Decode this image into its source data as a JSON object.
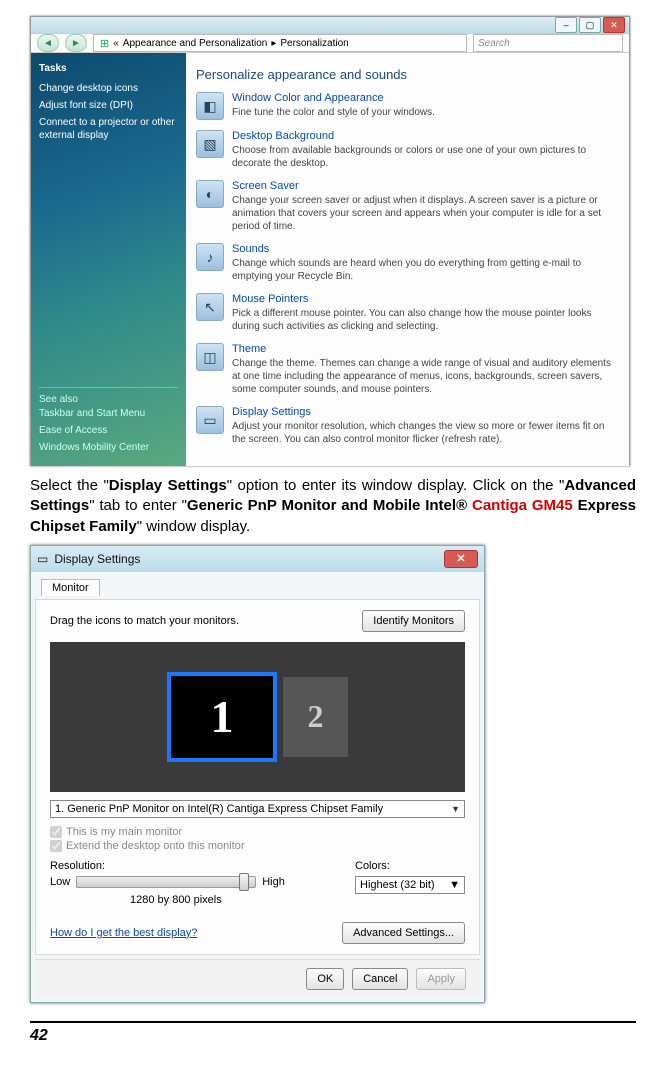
{
  "win1": {
    "breadcrumb_prefix": "«",
    "breadcrumb1": "Appearance and Personalization",
    "breadcrumb_sep": "▸",
    "breadcrumb2": "Personalization",
    "search_placeholder": "Search",
    "sidebar": {
      "heading": "Tasks",
      "tasks": [
        "Change desktop icons",
        "Adjust font size (DPI)",
        "Connect to a projector or other external display"
      ],
      "seealso_heading": "See also",
      "seealso": [
        "Taskbar and Start Menu",
        "Ease of Access",
        "Windows Mobility Center"
      ]
    },
    "main_heading": "Personalize appearance and sounds",
    "items": [
      {
        "icon": "◧",
        "title": "Window Color and Appearance",
        "desc": "Fine tune the color and style of your windows."
      },
      {
        "icon": "▧",
        "title": "Desktop Background",
        "desc": "Choose from available backgrounds or colors or use one of your own pictures to decorate the desktop."
      },
      {
        "icon": "◐",
        "title": "Screen Saver",
        "desc": "Change your screen saver or adjust when it displays. A screen saver is a picture or animation that covers your screen and appears when your computer is idle for a set period of time."
      },
      {
        "icon": "♪",
        "title": "Sounds",
        "desc": "Change which sounds are heard when you do everything from getting e-mail to emptying your Recycle Bin."
      },
      {
        "icon": "↖",
        "title": "Mouse Pointers",
        "desc": "Pick a different mouse pointer. You can also change how the mouse pointer looks during such activities as clicking and selecting."
      },
      {
        "icon": "◫",
        "title": "Theme",
        "desc": "Change the theme. Themes can change a wide range of visual and auditory elements at one time including the appearance of menus, icons, backgrounds, screen savers, some computer sounds, and mouse pointers."
      },
      {
        "icon": "▭",
        "title": "Display Settings",
        "desc": "Adjust your monitor resolution, which changes the view so more or fewer items fit on the screen. You can also control monitor flicker (refresh rate)."
      }
    ]
  },
  "instr": {
    "t1": "Select the \"",
    "b1": "Display Settings",
    "t2": "\" option to enter its window display. Click on the \"",
    "b2": "Advanced Settings",
    "t3": "\" tab to enter \"",
    "b3": "Generic PnP Monitor and Mobile Intel® ",
    "red": "Cantiga GM45",
    "b4": " Express Chipset Family",
    "t4": "\" window display."
  },
  "dlg": {
    "icon": "▭",
    "title": "Display Settings",
    "tab": "Monitor",
    "drag_label": "Drag the icons to match your monitors.",
    "identify_btn": "Identify Monitors",
    "mon1": "1",
    "mon2": "2",
    "dropdown_value": "1. Generic PnP Monitor on Intel(R) Cantiga Express Chipset Family",
    "chk_main": "This is my main monitor",
    "chk_extend": "Extend the desktop onto this monitor",
    "res_label": "Resolution:",
    "res_low": "Low",
    "res_high": "High",
    "res_value": "1280 by 800 pixels",
    "colors_label": "Colors:",
    "colors_value": "Highest (32 bit)",
    "help_link": "How do I get the best display?",
    "adv_btn": "Advanced Settings...",
    "ok": "OK",
    "cancel": "Cancel",
    "apply": "Apply"
  },
  "page_number": "42"
}
